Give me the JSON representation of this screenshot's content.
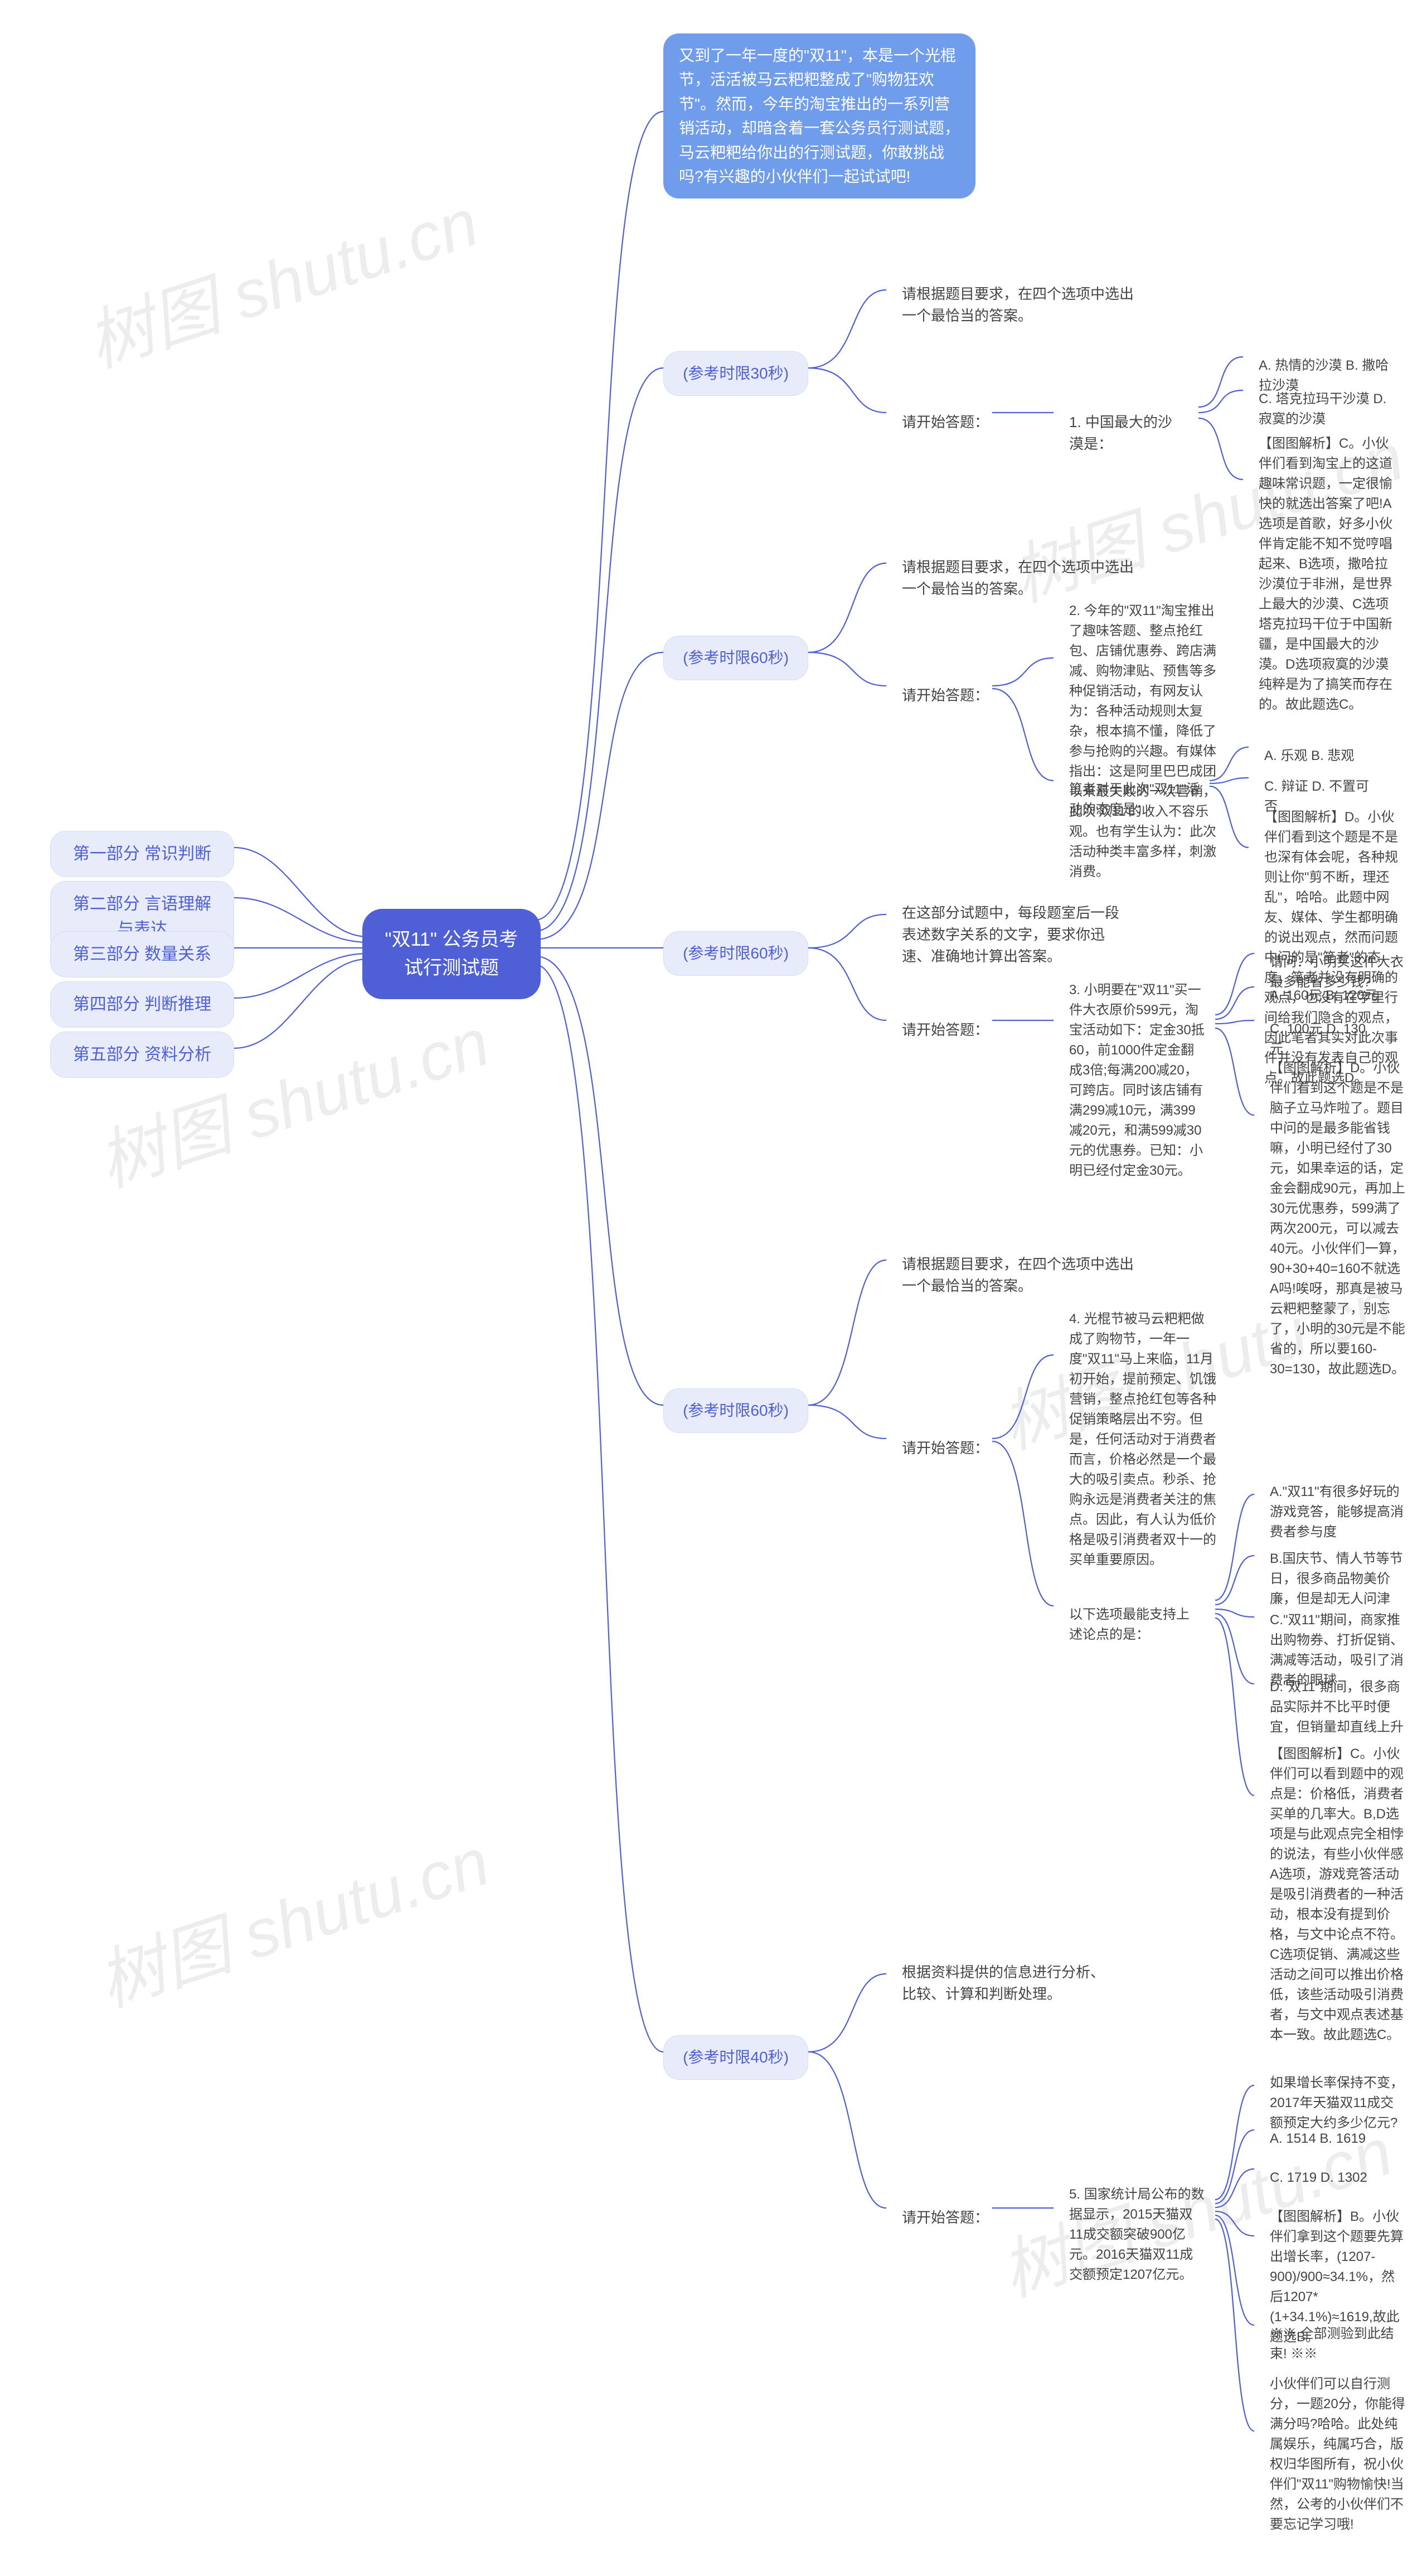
{
  "watermark": "树图 shutu.cn",
  "root": {
    "title": "\"双11\" 公务员考试行测试题"
  },
  "intro": "又到了一年一度的\"双11\"，本是一个光棍节，活活被马云粑粑整成了\"购物狂欢节\"。然而，今年的淘宝推出的一系列营销活动，却暗含着一套公务员行测试题，马云粑粑给你出的行测试题，你敢挑战吗?有兴趣的小伙伴们一起试试吧!",
  "left_sections": [
    "第一部分 常识判断",
    "第二部分 言语理解与表达",
    "第三部分 数量关系",
    "第四部分 判断推理",
    "第五部分 资料分析"
  ],
  "timers": {
    "q1": "(参考时限30秒)",
    "q2": "(参考时限60秒)",
    "q3": "(参考时限60秒)",
    "q4": "(参考时限60秒)",
    "q5": "(参考时限40秒)"
  },
  "common": {
    "instruct_mc": "请根据题目要求，在四个选项中选出一个最恰当的答案。",
    "begin": "请开始答题：",
    "instruct_math": "在这部分试题中，每段题室后一段表述数字关系的文字，要求你迅速、准确地计算出答案。",
    "instruct_data": "根据资料提供的信息进行分析、比较、计算和判断处理。"
  },
  "q1": {
    "stem": "1. 中国最大的沙漠是：",
    "opt_ab": "A. 热情的沙漠  B. 撒哈拉沙漠",
    "opt_cd": "C. 塔克拉玛干沙漠  D. 寂寞的沙漠",
    "analysis": "【图图解析】C。小伙伴们看到淘宝上的这道趣味常识题，一定很愉快的就选出答案了吧!A选项是首歌，好多小伙伴肯定能不知不觉哼唱起来、B选项，撒哈拉沙漠位于非洲，是世界上最大的沙漠、C选项塔克拉玛干位于中国新疆，是中国最大的沙漠。D选项寂寞的沙漠纯粹是为了搞笑而存在的。故此题选C。"
  },
  "q2": {
    "stem": "2. 今年的\"双11\"淘宝推出了趣味答题、整点抢红包、店铺优惠券、跨店满减、购物津贴、预售等多种促销活动，有网友认为：各种活动规则太复杂，根本搞不懂，降低了参与抢购的兴趣。有媒体指出：这是阿里巴巴成团以来最失败的一次营销，此次'双11'的收入不容乐观。也有学生认为：此次活动种类丰富多样，刺激消费。",
    "attitude_stem": "笔者对于此次\"双11\"活动的态度是：",
    "opt_ab": "A. 乐观  B. 悲观",
    "opt_cd": "C. 辩证  D. 不置可否",
    "analysis": "【图图解析】D。小伙伴们看到这个题是不是也深有体会呢，各种规则让你\"剪不断，理还乱\"，哈哈。此题中网友、媒体、学生都明确的说出观点，然而问题中问的是\"笔者\"的态度，笔者并没有明确的观点，也没有在字里行间给我们隐含的观点，因此笔者其实对此次事件并没有发表自己的观点。故此题选D。"
  },
  "q3": {
    "stem": "3. 小明要在\"双11\"买一件大衣原价599元，淘宝活动如下：定金30抵60，前1000件定金翻成3倍;每满200减20，可跨店。同时该店铺有满299减10元，满399减20元，和满599减30元的优惠券。已知：小明已经付定金30元。",
    "ask": "请问：小明买这件大衣最多能省多少钱?",
    "opt_ab": "A. 160元  B. 120元",
    "opt_cd": "C. 100元  D. 130元",
    "analysis": "【图图解析】D。小伙伴们看到这个题是不是脑子立马炸啦了。题目中问的是最多能省钱嘛，小明已经付了30元，如果幸运的话，定金会翻成90元，再加上30元优惠券，599满了两次200元，可以减去40元。小伙伴们一算，90+30+40=160不就选A吗!唉呀，那真是被马云粑粑整蒙了，别忘了，小明的30元是不能省的，所以要160-30=130，故此题选D。"
  },
  "q4": {
    "stem": "4. 光棍节被马云粑粑做成了购物节，一年一度\"双11\"马上来临，11月初开始，提前预定、饥饿营销，整点抢红包等各种促销策略层出不穷。但是，任何活动对于消费者而言，价格必然是一个最大的吸引卖点。秒杀、抢购永远是消费者关注的焦点。因此，有人认为低价格是吸引消费者双十一的买单重要原因。",
    "support_stem": "以下选项最能支持上述论点的是：",
    "opt_a": "A.\"双11\"有很多好玩的游戏竞答，能够提高消费者参与度",
    "opt_b": "B.国庆节、情人节等节日，很多商品物美价廉，但是却无人问津",
    "opt_c": "C.\"双11\"期间，商家推出购物券、打折促销、满减等活动，吸引了消费者的眼球",
    "opt_d": "D.\"双11\"期间，很多商品实际并不比平时便宜，但销量却直线上升",
    "analysis": "【图图解析】C。小伙伴们可以看到题中的观点是：价格低，消费者买单的几率大。B,D选项是与此观点完全相悖的说法，有些小伙伴感A选项，游戏竞答活动是吸引消费者的一种活动，根本没有提到价格，与文中论点不符。C选项促销、满减这些活动之间可以推出价格低，该些活动吸引消费者，与文中观点表述基本一致。故此题选C。"
  },
  "q5": {
    "stem": "5. 国家统计局公布的数据显示，2015天猫双11成交额突破900亿元。2016天猫双11成交额预定1207亿元。",
    "ask": "如果增长率保持不变，2017年天猫双11成交额预定大约多少亿元?",
    "opt_ab": "A. 1514  B. 1619",
    "opt_cd": "C. 1719  D. 1302",
    "analysis": "【图图解析】B。小伙伴们拿到这个题要先算出增长率，(1207-900)/900≈34.1%，然后1207*(1+34.1%)≈1619,故此题选B。",
    "footer1": "※※ 全部测验到此结束! ※※",
    "footer2": "小伙伴们可以自行测分，一题20分，你能得满分吗?哈哈。此处纯属娱乐，纯属巧合，版权归华图所有，祝小伙伴们\"双11\"购物愉快!当然，公考的小伙伴们不要忘记学习哦!"
  }
}
